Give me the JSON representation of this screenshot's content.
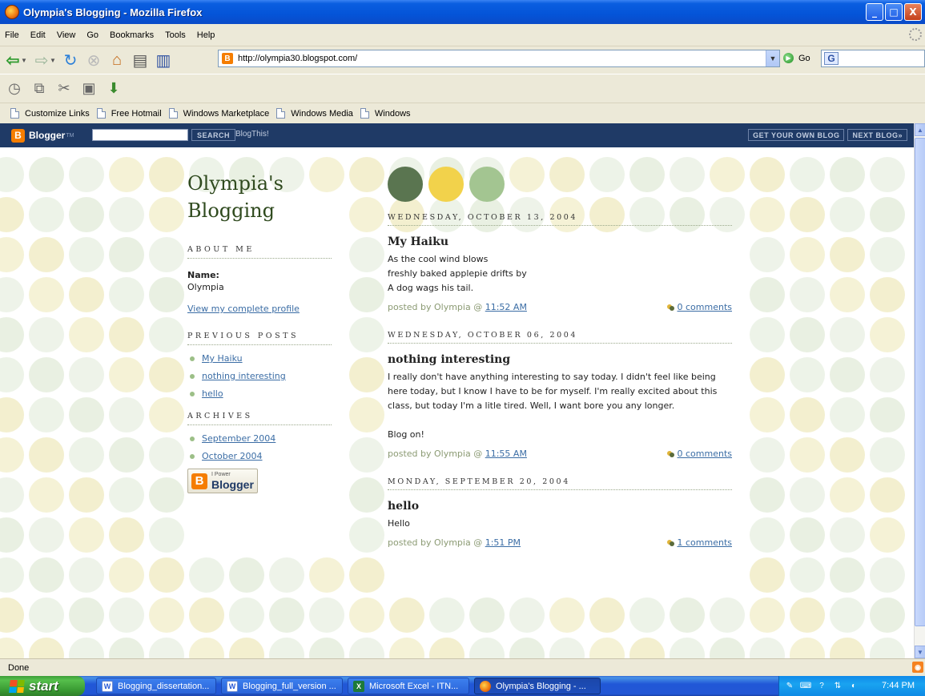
{
  "window": {
    "title": "Olympia's Blogging - Mozilla Firefox",
    "controls": {
      "minimize": "_",
      "maximize": "□",
      "close": "X"
    }
  },
  "menu": [
    "File",
    "Edit",
    "View",
    "Go",
    "Bookmarks",
    "Tools",
    "Help"
  ],
  "nav": {
    "url": "http://olympia30.blogspot.com/",
    "go_label": "Go",
    "search_value": ""
  },
  "links_toolbar": [
    "Customize Links",
    "Free Hotmail",
    "Windows Marketplace",
    "Windows Media",
    "Windows"
  ],
  "blogger_bar": {
    "logo": "Blogger",
    "tm": "TM",
    "search_button": "SEARCH",
    "blogthis": "BlogThis!",
    "get_blog": "GET YOUR OWN BLOG",
    "next_blog": "NEXT BLOG»"
  },
  "sidebar": {
    "blog_title_line1": "Olympia's",
    "blog_title_line2": "Blogging",
    "about_heading": "ABOUT ME",
    "name_label": "Name:",
    "name_value": "Olympia",
    "profile_link": "View my complete profile",
    "previous_heading": "PREVIOUS POSTS",
    "previous_posts": [
      "My Haiku",
      "nothing interesting",
      "hello"
    ],
    "archives_heading": "ARCHIVES",
    "archives": [
      "September 2004",
      "October 2004"
    ],
    "badge_small": "I Power",
    "badge_big": "Blogger"
  },
  "posts": [
    {
      "date": "WEDNESDAY, OCTOBER 13, 2004",
      "title": "My Haiku",
      "body": [
        "As the cool wind blows",
        "freshly baked applepie drifts by",
        "A dog wags his tail."
      ],
      "posted_by": "posted by Olympia @ ",
      "time": "11:52 AM",
      "comments": "0 comments"
    },
    {
      "date": "WEDNESDAY, OCTOBER 06, 2004",
      "title": "nothing interesting",
      "body": [
        "I really don't have anything interesting to say today. I didn't feel like being here today, but I know I have to be for myself. I'm really excited about this class, but today I'm a litle tired. Well, I want bore you any longer.",
        "Blog on!"
      ],
      "posted_by": "posted by Olympia @ ",
      "time": "11:55 AM",
      "comments": "0 comments"
    },
    {
      "date": "MONDAY, SEPTEMBER 20, 2004",
      "title": "hello",
      "body": [
        "Hello"
      ],
      "posted_by": "posted by Olympia @ ",
      "time": "1:51 PM",
      "comments": "1 comments"
    }
  ],
  "status": "Done",
  "taskbar": {
    "start": "start",
    "tasks": [
      {
        "label": "Blogging_dissertation...",
        "icon": "word-doc-icon"
      },
      {
        "label": "Blogging_full_version ...",
        "icon": "word-doc-icon"
      },
      {
        "label": "Microsoft Excel - ITN...",
        "icon": "excel-icon"
      },
      {
        "label": "Olympia's Blogging - ...",
        "icon": "firefox-icon"
      }
    ],
    "clock": "7:44 PM"
  },
  "colors": {
    "dark_green": "#5a7550",
    "yellow": "#f2d24b",
    "sage": "#a3c591",
    "blogger_navy": "#1f3a66"
  }
}
